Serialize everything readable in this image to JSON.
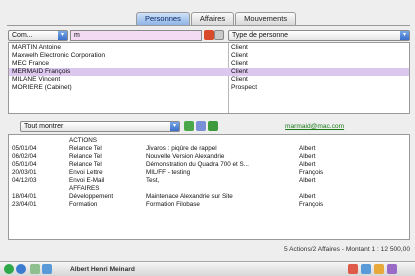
{
  "tabs": [
    {
      "label": "Personnes",
      "active": true
    },
    {
      "label": "Affaires",
      "active": false
    },
    {
      "label": "Mouvements",
      "active": false
    }
  ],
  "filter": {
    "left_select": "Com...",
    "search_value": "m",
    "type_select": "Type de personne"
  },
  "contacts": [
    {
      "name": "MARTIN Antoine",
      "type": "Client"
    },
    {
      "name": "Maxwelh Electronic Corporation",
      "type": "Client"
    },
    {
      "name": "MEC France",
      "type": "Client"
    },
    {
      "name": "MERMAID François",
      "type": "Client",
      "selected": true
    },
    {
      "name": "MILANE Vincent",
      "type": "Client"
    },
    {
      "name": "MORIERE (Cabinet)",
      "type": "Prospect"
    }
  ],
  "show_select": "Tout montrer",
  "email": "marmaid@mac.com",
  "actions": [
    {
      "date": "",
      "kind": "ACTIONS",
      "desc": "",
      "who": ""
    },
    {
      "date": "05/01/04",
      "kind": "Relance Tel",
      "desc": "Jivaros : piqûre de rappel",
      "who": "Albert"
    },
    {
      "date": "06/02/04",
      "kind": "Relance Tel",
      "desc": "Nouvelle Version Alexandrie",
      "who": "Albert"
    },
    {
      "date": "05/01/04",
      "kind": "Relance Tel",
      "desc": "Démonstration du Quadra 700 et S...",
      "who": "Albert"
    },
    {
      "date": "20/03/01",
      "kind": "Envoi Lettre",
      "desc": "MIL/FF - testing",
      "who": "François"
    },
    {
      "date": "04/12/03",
      "kind": "Envoi E-Mail",
      "desc": "Test,",
      "who": "Albert"
    },
    {
      "date": "",
      "kind": "AFFAIRES",
      "desc": "",
      "who": ""
    },
    {
      "date": "18/04/01",
      "kind": "Développement",
      "desc": "Maintenace Alexandrie sur Site",
      "who": "Albert"
    },
    {
      "date": "23/04/01",
      "kind": "Formation",
      "desc": "Formation Filobase",
      "who": "François"
    }
  ],
  "status": "5 Actions/2 Affaires - Montant 1 : 12 500,00",
  "user": "Albert Henri Meinard",
  "colors": {
    "selection": "#dcc7ef",
    "search_field": "#f3dcf3",
    "link": "#1a7a1a"
  }
}
